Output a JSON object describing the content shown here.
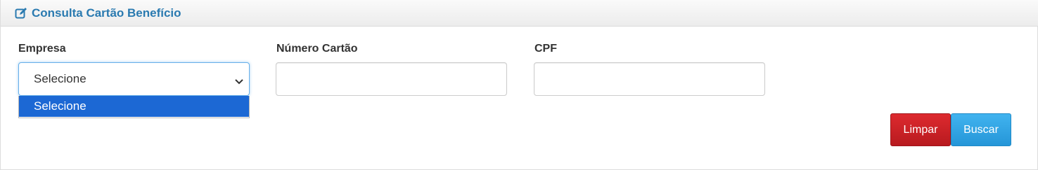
{
  "header": {
    "title": "Consulta Cartão Benefício",
    "icon": "edit-icon",
    "title_color": "#2a7ab0"
  },
  "form": {
    "empresa": {
      "label": "Empresa",
      "selected": "Selecione",
      "options": [
        "Selecione"
      ],
      "highlight_color": "#1c68d4"
    },
    "numero_cartao": {
      "label": "Número Cartão",
      "value": ""
    },
    "cpf": {
      "label": "CPF",
      "value": ""
    }
  },
  "buttons": {
    "limpar": {
      "label": "Limpar",
      "color": "#c81e24"
    },
    "buscar": {
      "label": "Buscar",
      "color": "#2fa4e7"
    }
  }
}
